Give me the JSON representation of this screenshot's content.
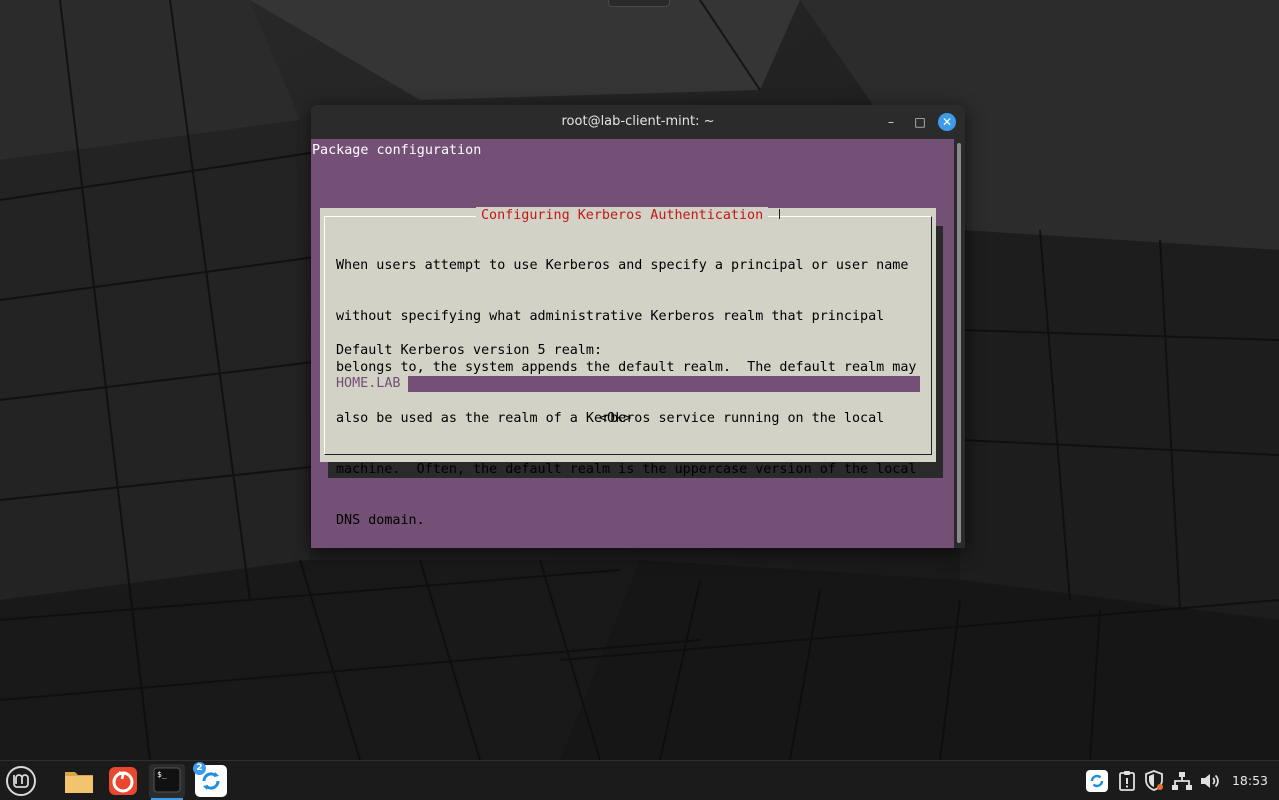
{
  "window": {
    "title": "root@lab-client-mint: ~",
    "minimize_glyph": "–",
    "maximize_glyph": "□",
    "close_glyph": "✕"
  },
  "terminal": {
    "header": "Package configuration",
    "background_color": "#744f76"
  },
  "dialog": {
    "title": "Configuring Kerberos Authentication",
    "title_color": "#c21818",
    "body_lines": [
      "When users attempt to use Kerberos and specify a principal or user name",
      "without specifying what administrative Kerberos realm that principal",
      "belongs to, the system appends the default realm.  The default realm may",
      "also be used as the realm of a Kerberos service running on the local",
      "machine.  Often, the default realm is the uppercase version of the local",
      "DNS domain."
    ],
    "prompt": "Default Kerberos version 5 realm:",
    "input_value": "HOME.LAB",
    "ok_label": "<Ok>"
  },
  "taskbar": {
    "launchers": [
      {
        "name": "menu-icon"
      },
      {
        "name": "files-folder-icon"
      },
      {
        "name": "firefox-icon"
      },
      {
        "name": "terminal-icon",
        "active": true
      },
      {
        "name": "update-manager-icon",
        "badge": "2"
      }
    ],
    "update_badge": "2",
    "tray": [
      "update-manager-icon",
      "clipboard-icon",
      "shield-icon",
      "network-icon",
      "volume-icon"
    ],
    "clock": "18:53",
    "accent_color": "#3d9be9"
  }
}
